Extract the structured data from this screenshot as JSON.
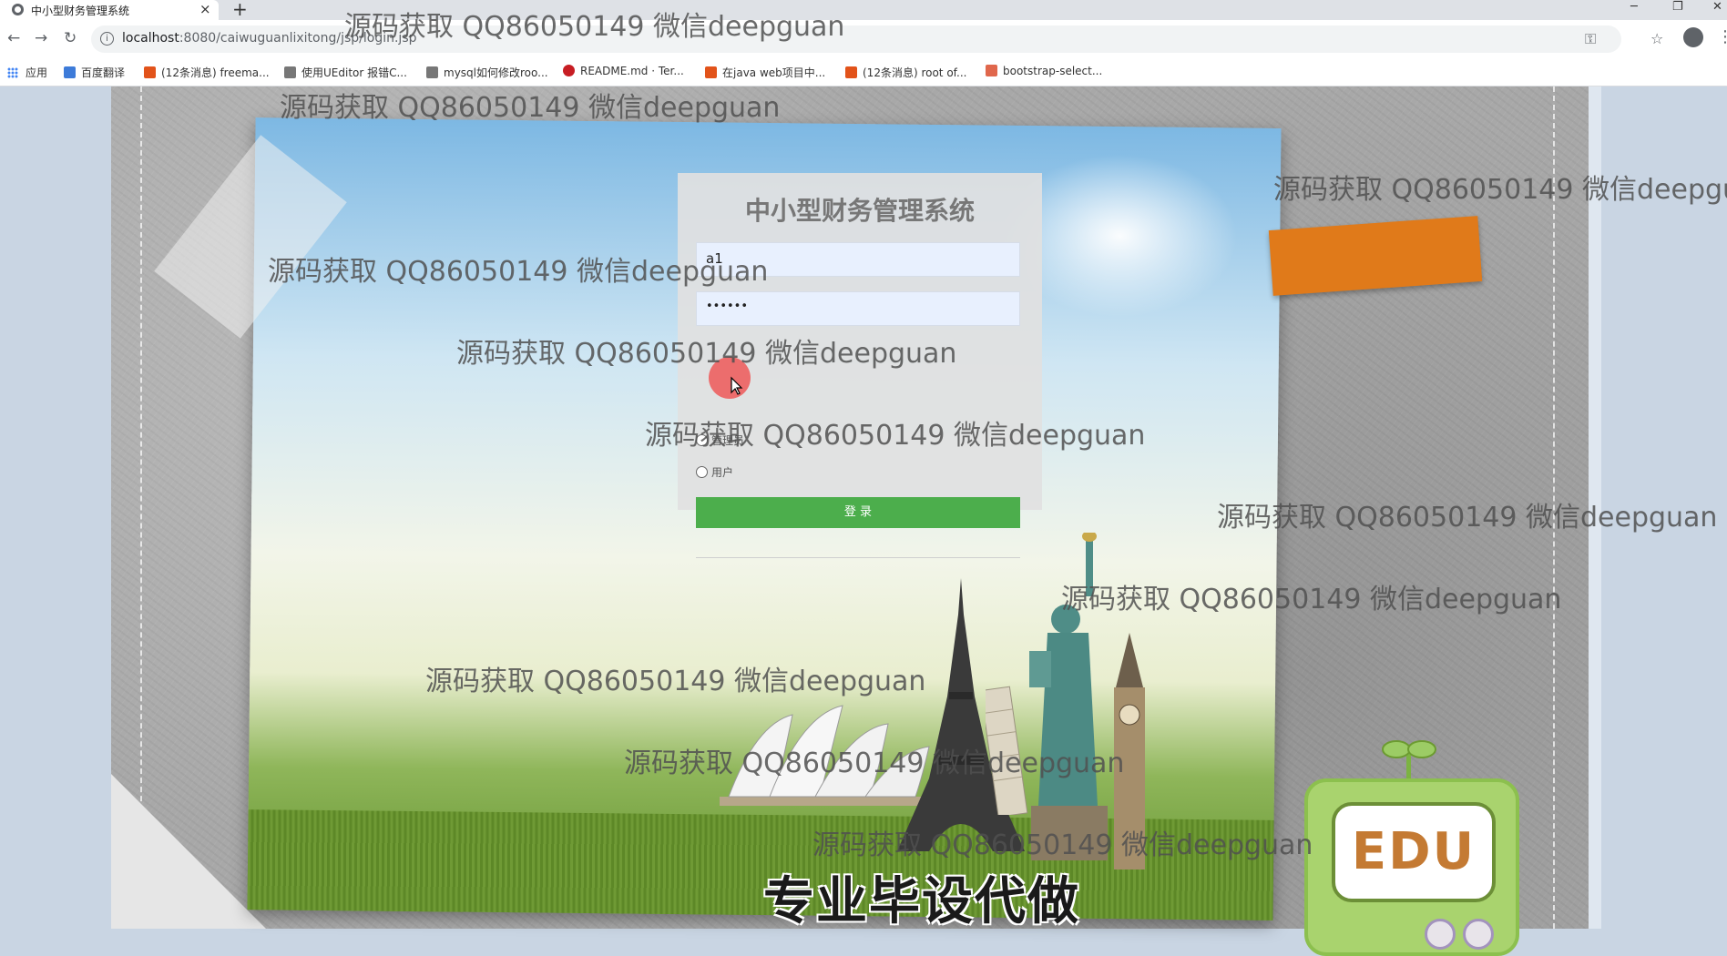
{
  "browser": {
    "tab_title": "中小型财务管理系统",
    "tab_close": "×",
    "new_tab": "+",
    "url_host": "localhost",
    "url_rest": ":8080/caiwuguanlixitong/jsp/login.jsp",
    "bookmarks": [
      {
        "label": "应用",
        "icon": "apps-grid-icon"
      },
      {
        "label": "百度翻译",
        "icon": "translate-icon",
        "color": "#3d7bd9"
      },
      {
        "label": "(12条消息) freema...",
        "icon": "csdn-icon",
        "color": "#e2531a"
      },
      {
        "label": "使用UEditor 报错C...",
        "icon": "bird-icon",
        "color": "#444444"
      },
      {
        "label": "mysql如何修改roo...",
        "icon": "bird-icon",
        "color": "#444444"
      },
      {
        "label": "README.md · Ter...",
        "icon": "gitee-icon",
        "color": "#c71d23"
      },
      {
        "label": "在java web项目中...",
        "icon": "csdn-icon",
        "color": "#e2531a"
      },
      {
        "label": "(12条消息) root of...",
        "icon": "csdn-icon",
        "color": "#e2531a"
      },
      {
        "label": "bootstrap-select...",
        "icon": "jianshu-icon",
        "color": "#e0674c"
      }
    ]
  },
  "login": {
    "title": "中小型财务管理系统",
    "username_value": "a1",
    "password_value": "••••••",
    "radio_1_label": "管理员",
    "radio_2_label": "用户",
    "submit_label": "登 录"
  },
  "overlay": {
    "slogan": "专业毕设代做",
    "edu_label": "EDU",
    "watermark_text": "源码获取 QQ86050149 微信deepguan"
  },
  "colors": {
    "login_button": "#4cae4c",
    "orange_tape": "#e07a1a",
    "edu_tv": "#a9d36e"
  }
}
